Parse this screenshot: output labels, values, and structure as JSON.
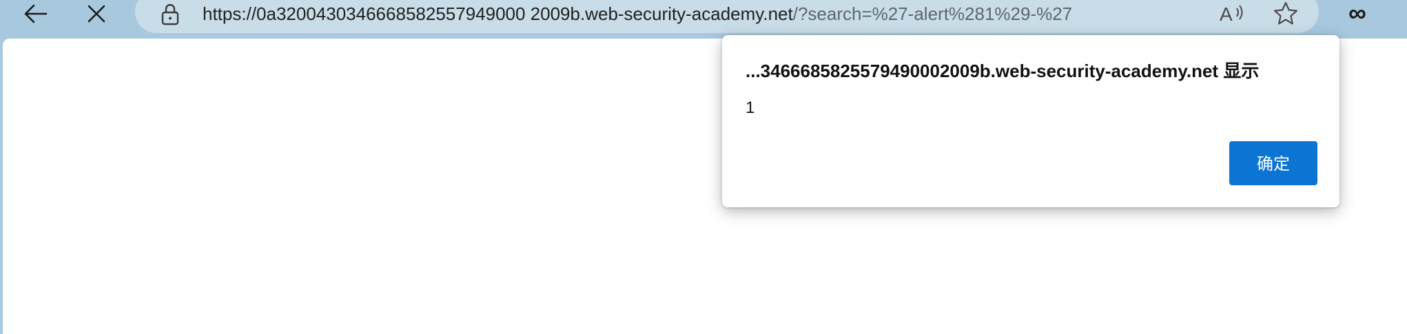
{
  "browser": {
    "url_host": "https://0a3200430346668582557949000 2009b.web-security-academy.net",
    "url_query": "/?search=%27-alert%281%29-%27"
  },
  "dialog": {
    "title": "...3466685825579490002009b.web-security-academy.net 显示",
    "message": "1",
    "ok_label": "确定"
  },
  "colors": {
    "toolbar_bg": "#a7c8dd",
    "address_bar_bg": "#c9dde9",
    "button_primary": "#0c74d3"
  },
  "icons": {
    "back": "back-arrow-icon",
    "stop": "close-icon",
    "lock": "lock-icon",
    "read_aloud": "read-aloud-icon",
    "favorite": "star-icon",
    "extension": "infinity-icon"
  }
}
